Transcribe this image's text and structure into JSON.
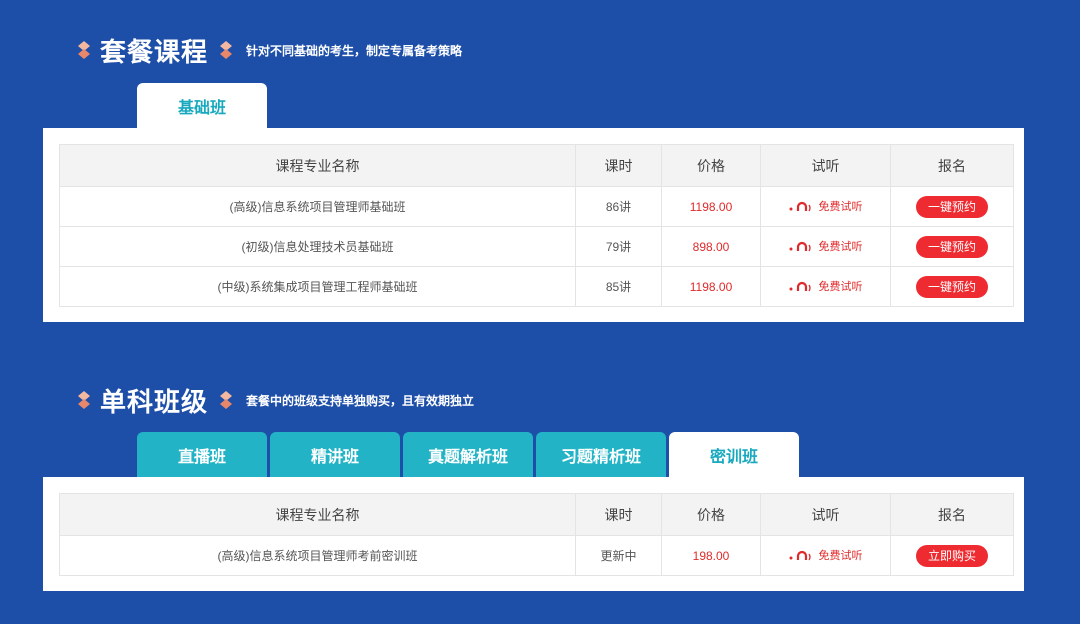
{
  "section1": {
    "title": "套餐课程",
    "subtitle": "针对不同基础的考生，制定专属备考策略",
    "tabs": [
      {
        "label": "基础班"
      }
    ],
    "headers": [
      "课程专业名称",
      "课时",
      "价格",
      "试听",
      "报名"
    ],
    "rows": [
      {
        "name": "(高级)信息系统项目管理师基础班",
        "hours": "86讲",
        "price": "1198.00",
        "listen": "免费试听",
        "action": "一键预约"
      },
      {
        "name": "(初级)信息处理技术员基础班",
        "hours": "79讲",
        "price": "898.00",
        "listen": "免费试听",
        "action": "一键预约"
      },
      {
        "name": "(中级)系统集成项目管理工程师基础班",
        "hours": "85讲",
        "price": "1198.00",
        "listen": "免费试听",
        "action": "一键预约"
      }
    ]
  },
  "section2": {
    "title": "单科班级",
    "subtitle": "套餐中的班级支持单独购买，且有效期独立",
    "tabs": [
      {
        "label": "直播班"
      },
      {
        "label": "精讲班"
      },
      {
        "label": "真题解析班"
      },
      {
        "label": "习题精析班"
      },
      {
        "label": "密训班"
      }
    ],
    "headers": [
      "课程专业名称",
      "课时",
      "价格",
      "试听",
      "报名"
    ],
    "rows": [
      {
        "name": "(高级)信息系统项目管理师考前密训班",
        "hours": "更新中",
        "price": "198.00",
        "listen": "免费试听",
        "action": "立即购买"
      }
    ]
  },
  "colors": {
    "background": "#1e4fa8",
    "tab": "#22b4c6",
    "accent_red": "#ee2b31",
    "diamond": "#f0a37a"
  }
}
